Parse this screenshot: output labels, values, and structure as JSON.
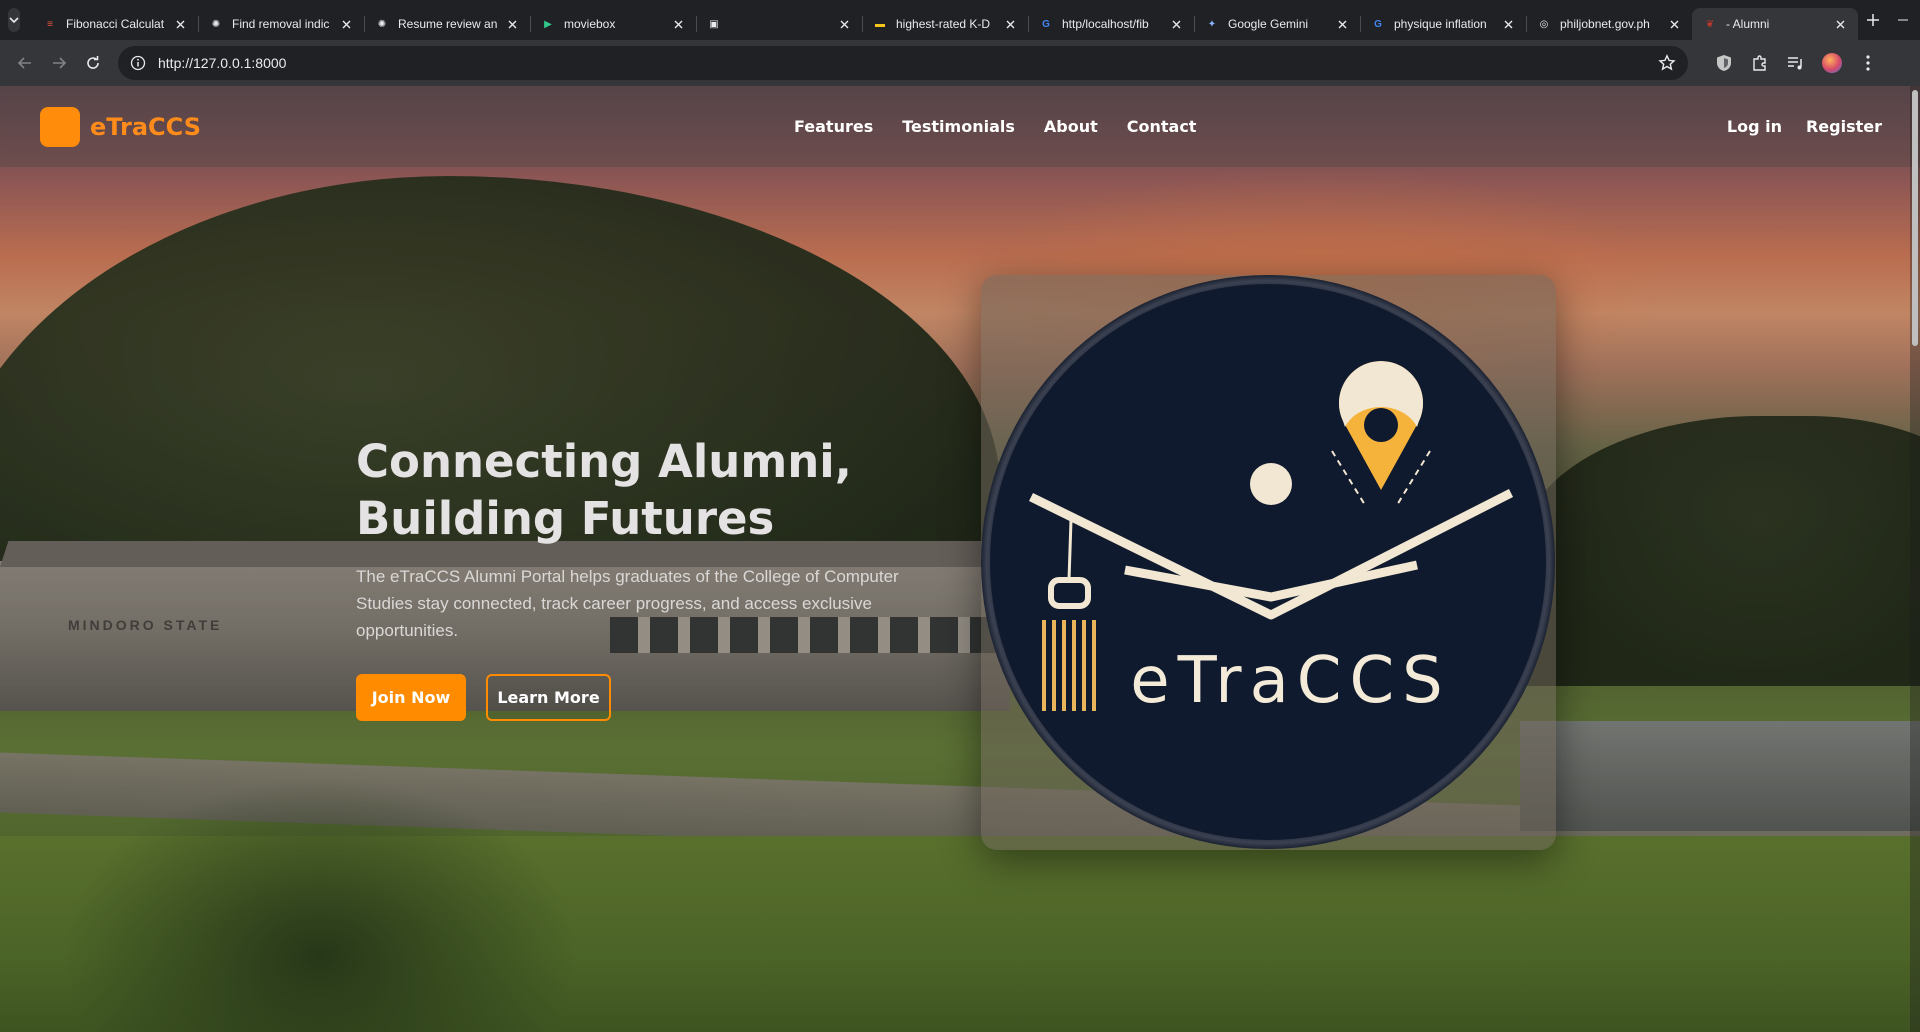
{
  "browser": {
    "tabs": [
      {
        "title": "Fibonacci Calculat",
        "icon": "calculator-favicon",
        "color": "#e8553a",
        "active": false
      },
      {
        "title": "Find removal indic",
        "icon": "openai-favicon",
        "color": "#e8eaed",
        "active": false
      },
      {
        "title": "Resume review an",
        "icon": "openai-favicon",
        "color": "#e8eaed",
        "active": false
      },
      {
        "title": "moviebox",
        "icon": "moviebox-favicon",
        "color": "#34c98e",
        "active": false
      },
      {
        "title": "",
        "icon": "picture-in-picture-favicon",
        "color": "#e8eaed",
        "active": false
      },
      {
        "title": "highest-rated K-D",
        "icon": "imdb-favicon",
        "color": "#f5c518",
        "active": false
      },
      {
        "title": "http/localhost/fib",
        "icon": "google-favicon",
        "color": "#4285f4",
        "active": false
      },
      {
        "title": "Google Gemini",
        "icon": "gemini-favicon",
        "color": "#8ab4f8",
        "active": false
      },
      {
        "title": "physique inflation",
        "icon": "google-favicon",
        "color": "#4285f4",
        "active": false
      },
      {
        "title": "philjobnet.gov.ph",
        "icon": "globe-favicon",
        "color": "#e8eaed",
        "active": false
      },
      {
        "title": "- Alumni",
        "icon": "alumni-favicon",
        "color": "#c0392b",
        "active": true
      }
    ],
    "url": "http://127.0.0.1:8000"
  },
  "site": {
    "brand": "eTraCCS",
    "nav": [
      "Features",
      "Testimonials",
      "About",
      "Contact"
    ],
    "auth": {
      "login": "Log in",
      "register": "Register"
    },
    "accent": "#ff8c00"
  },
  "hero": {
    "title_line1": "Connecting Alumni,",
    "title_line2": "Building Futures",
    "description": "The eTraCCS Alumni Portal helps graduates of the College of Computer Studies stay connected, track career progress, and access exclusive opportunities.",
    "primary_cta": "Join Now",
    "secondary_cta": "Learn More",
    "background_sign": "MINDORO STATE"
  },
  "emblem": {
    "wordmark": "eTraCCS",
    "colors": {
      "circle": "#101a2e",
      "line": "#f1e7d2",
      "pin": "#f6b33c",
      "tassel": "#e9b45a"
    }
  }
}
